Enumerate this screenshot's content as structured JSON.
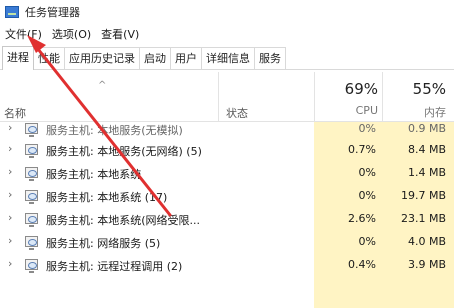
{
  "window": {
    "title": "任务管理器"
  },
  "menu": [
    {
      "label": "文件(F)"
    },
    {
      "label": "选项(O)"
    },
    {
      "label": "查看(V)"
    }
  ],
  "tabs": [
    {
      "label": "进程",
      "active": true
    },
    {
      "label": "性能"
    },
    {
      "label": "应用历史记录"
    },
    {
      "label": "启动"
    },
    {
      "label": "用户"
    },
    {
      "label": "详细信息"
    },
    {
      "label": "服务"
    }
  ],
  "header": {
    "sort_arrow": "^",
    "name": "名称",
    "status": "状态",
    "cpu_pct": "69%",
    "cpu_label": "CPU",
    "mem_pct": "55%",
    "mem_label": "内存"
  },
  "rows": [
    {
      "name": "服务主机: 本地服务(无模拟)",
      "cpu": "0%",
      "mem": "0.9 MB"
    },
    {
      "name": "服务主机: 本地服务(无网络) (5)",
      "cpu": "0.7%",
      "mem": "8.4 MB"
    },
    {
      "name": "服务主机: 本地系统",
      "cpu": "0%",
      "mem": "1.4 MB"
    },
    {
      "name": "服务主机: 本地系统 (17)",
      "cpu": "0%",
      "mem": "19.7 MB"
    },
    {
      "name": "服务主机: 本地系统(网络受限...",
      "cpu": "2.6%",
      "mem": "23.1 MB"
    },
    {
      "name": "服务主机: 网络服务 (5)",
      "cpu": "0%",
      "mem": "4.0 MB"
    },
    {
      "name": "服务主机: 远程过程调用 (2)",
      "cpu": "0.4%",
      "mem": "3.9 MB"
    }
  ],
  "colors": {
    "heat": "#fff4c4",
    "annotation_arrow": "#e03030"
  },
  "icons": {
    "app": "task-manager-icon",
    "row": "service-host-icon",
    "expand": "chevron-right-icon"
  }
}
